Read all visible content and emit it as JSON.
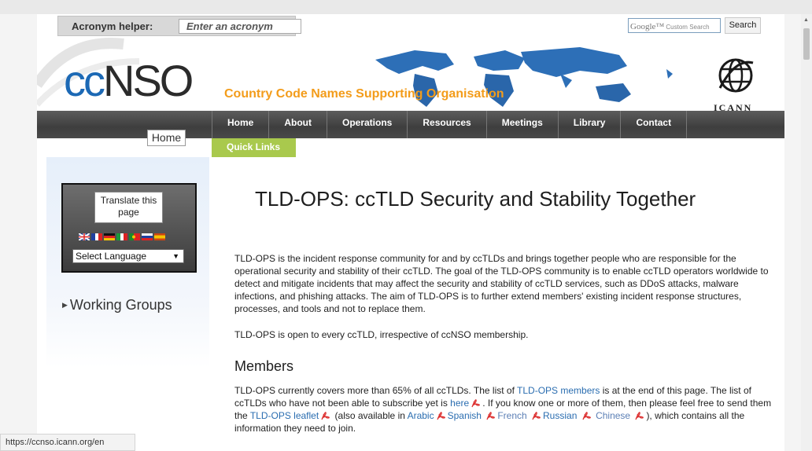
{
  "topbar": {
    "acronym_label": "Acronym helper:",
    "acronym_placeholder": "Enter an acronym",
    "google_brand": "Google™",
    "google_custom": "Custom Search",
    "search_label": "Search"
  },
  "header": {
    "logo_cc": "cc",
    "logo_nso": "NSO",
    "tagline": "Country Code Names Supporting Organisation",
    "icann_label": "ICANN"
  },
  "nav": {
    "home_chip": "Home",
    "items": [
      "Home",
      "About",
      "Operations",
      "Resources",
      "Meetings",
      "Library",
      "Contact"
    ],
    "quick_links": "Quick Links"
  },
  "sidebar": {
    "translate_label": "Translate this page",
    "language_select": "Select Language",
    "flags": [
      "uk",
      "france",
      "germany",
      "italy",
      "portugal",
      "russia",
      "spain"
    ],
    "working_groups": "Working Groups"
  },
  "main": {
    "title": "TLD-OPS: ccTLD Security and Stability Together",
    "intro": "TLD-OPS is the incident response community for and by ccTLDs and brings together people who are responsible for the operational security and stability of their ccTLD. The goal of the TLD-OPS community is to enable ccTLD operators worldwide to detect and mitigate incidents that may affect the security and stability of ccTLD services, such as DDoS attacks, malware infections, and phishing attacks. The aim of TLD-OPS is to further extend members' existing incident response structures, processes, and tools and not to replace them.",
    "open_text": "TLD-OPS is open to every ccTLD, irrespective of ccNSO membership.",
    "members_heading": "Members",
    "members": {
      "t1": "TLD-OPS currently covers more than 65% of all ccTLDs. The list of ",
      "link_members": "TLD-OPS members",
      "t2": " is at the end of this page. The list of ccTLDs who have not been able to subscribe yet is ",
      "link_here": "here",
      "t3": ". If you know one or more of them, then please feel free to send them the ",
      "link_leaflet": "TLD-OPS leaflet",
      "t4": " (also available in ",
      "link_arabic": "Arabic",
      "link_spanish": "Spanish",
      "link_french": "French",
      "link_russian": "Russian",
      "link_chinese": "Chinese",
      "t5": "), which contains all the information they need to join."
    }
  },
  "status_bar": "https://ccnso.icann.org/en"
}
